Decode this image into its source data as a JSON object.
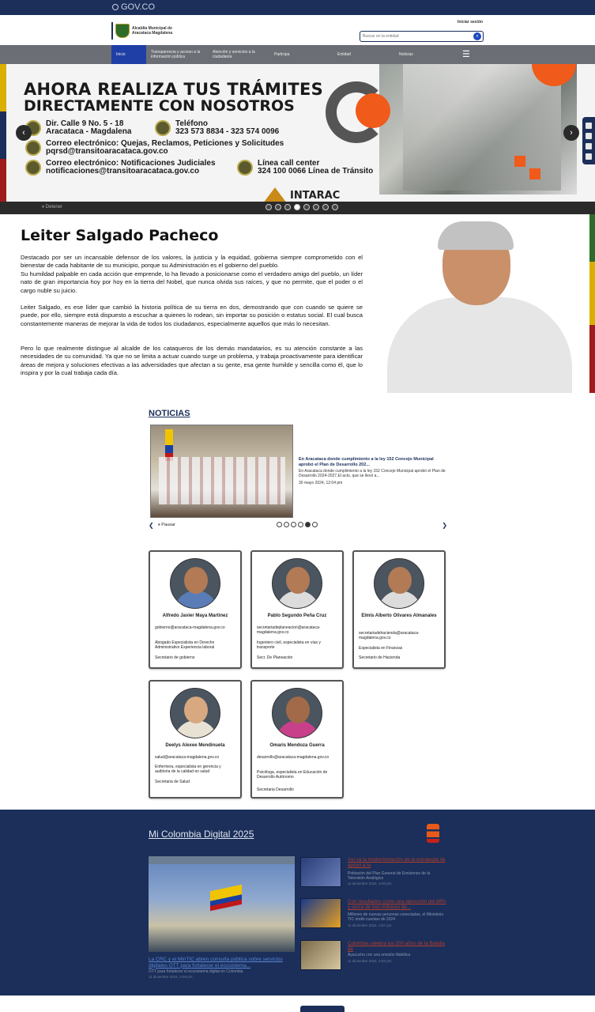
{
  "gov_bar": {
    "logo": "GOV.CO"
  },
  "header": {
    "site_name_line1": "Alcaldía Municipal de",
    "site_name_line2": "Aracataca Magdalena",
    "login": "Iniciar sesión",
    "search_placeholder": "Buscar en la entidad"
  },
  "nav": {
    "items": [
      "Inicio",
      "Transparencia y acceso a la información pública",
      "Atención y servicios a la ciudadanía",
      "Participa",
      "Entidad",
      "Noticias"
    ]
  },
  "hero": {
    "title_line1": "AHORA REALIZA TUS TRÁMITES",
    "title_line2": "DIRECTAMENTE CON NOSOTROS",
    "address_label": "Dir. Calle 9 No. 5 - 18",
    "address_city": "Aracataca - Magdalena",
    "phone_label": "Teléfono",
    "phone_numbers": "323 573 8834 - 323 574 0096",
    "email1_label": "Correo electrónico: Quejas, Reclamos, Peticiones y Solicitudes",
    "email1": "pqrsd@transitoaracataca.gov.co",
    "email2_label": "Correo electrónico: Notificaciones Judiciales",
    "email2": "notificaciones@transitoaracataca.gov.co",
    "callcenter_label": "Línea call center",
    "callcenter": "324 100 0066 Línea de Tránsito",
    "brand": "INTARAC",
    "stop_label": "Detener",
    "prev_icon": "chevron-left-icon",
    "next_icon": "chevron-right-icon"
  },
  "profile": {
    "name": "Leiter Salgado Pacheco",
    "paragraph1": "Destacado por ser un incansable defensor de los valores, la justicia y la equidad, gobierna siempre comprometido con el bienestar de cada habitante de su municipio, porque su Administración es el gobierno del pueblo.",
    "paragraph2": "Su humildad palpable en cada acción que emprende, lo ha llevado a posicionarse como el verdadero amigo del pueblo, un líder nato de gran importancia hoy por hoy en la tierra del Nobel, que nunca olvida sus raíces, y que no permite, que el poder o el cargo nuble su juicio.",
    "paragraph3": "Leiter Salgado, es ese líder que cambió la historia política de su tierra en dos, demostrando que con cuando se quiere se puede, por ello, siempre está dispuesto a escuchar a quienes lo rodean, sin importar su posición o estatus social. El cual busca constantemente maneras de mejorar la vida de todos los ciudadanos, especialmente aquellos que más lo necesitan.",
    "paragraph4": "Pero lo que realmente distingue al alcalde de los cataqueros de los demás mandatarios, es su atención constante a las necesidades de su comunidad. Ya que no se limita a actuar cuando surge un problema, y trabaja proactivamente para identificar áreas de mejora y soluciones efectivas a las adversidades que afectan a su gente, esa gente humilde y sencilla como él, que lo inspira y por la cual trabaja cada día."
  },
  "news": {
    "section_title": "NOTICIAS",
    "headline": "En Aracataca donde cumplimiento a la ley 152 Concejo Municipal aprobó el Plan de Desarrollo 202...",
    "summary": "En Aracataca donde cumplimiento a la ley 152 Concejo Municipal aprobó el Plan de Desarrollo 2024-2027.El acto, que se llevó a...",
    "date": "30 mayo 2024, 12:04 pm",
    "pause_label": "Pausar"
  },
  "staff": [
    {
      "name": "Alfredo Javier Maya Martínez",
      "email": "gobierno@aracataca-magdalena.gov.co",
      "profession": "Abogado Especialista en Derecho Administrativo Experiencia laboral",
      "role": "Secretario de gobierno"
    },
    {
      "name": "Pablo Segundo Peña Cruz",
      "email": "secretariadeplaneacion@aracataca-magdalena.gov.co",
      "profession": "Ingeniero civil, especialista en vías y transporte",
      "role": "Secr. De Planeación"
    },
    {
      "name": "Elmis Alberto Olivares Almanales",
      "email": "secretariadehacienda@aracataca-magdalena.gov.co",
      "profession": "Especialista en Finanzas",
      "role": "Secretario de Hacienda"
    },
    {
      "name": "Deelys Alexee Mendinueta",
      "email": "salud@aracataca-magdalena.gov.co",
      "profession": "Enfermera, especialista en gerencia y auditoría de la calidad en salud",
      "role": "Secretaria de Salud"
    },
    {
      "name": "Omaris Mendoza Guerra",
      "email": "desarrollo@aracataca-magdalena.gov.co",
      "profession": "Psicóloga, especialista en Educación de Desarrollo Autónomo",
      "role": "Secretaria Desarrollo"
    }
  ],
  "mcd": {
    "title": "Mi Colombia Digital 2025",
    "main": {
      "headline": "La CRC y el MinTIC abren consulta pública sobre servicios digitales OTT para fortalecer el ecosistema...",
      "summary": "OTT para fortalecer el ecosistema digital en Colombia",
      "date": "11 diciembre 2024, 4:59 pm"
    },
    "items": [
      {
        "headline": "Así va la implementación de la estrategia de apoyo a la",
        "summary": "Población del Plan General de Emisiones de la Televisión Analógica",
        "date": "11 diciembre 2024, 5:00 pm"
      },
      {
        "headline": "Con resultados como una ejecución del 88% y cerca de tres millones de...",
        "summary": "Millones de nuevas personas conectadas, el Ministerio TIC rindió cuentas de 2024",
        "date": "11 diciembre 2024, 4:57 pm"
      },
      {
        "headline": "Colombia celebra los 200 años de la Batalla de",
        "summary": "Ayacucho con una emisión filatélica",
        "date": "11 diciembre 2024, 4:52 pm"
      }
    ]
  },
  "colors": {
    "gov_blue": "#1b2f5a",
    "accent_orange": "#f05a1a",
    "nav_gray": "#6b6f75",
    "link_blue": "#1f3fa6"
  }
}
